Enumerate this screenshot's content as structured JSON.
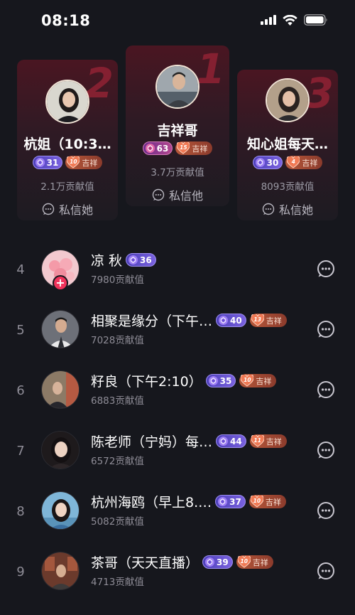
{
  "status_bar": {
    "time": "08:18"
  },
  "podium": [
    {
      "rank": "2",
      "name": "杭姐（10:3…",
      "level": "31",
      "fan_level": "10",
      "fan_name": "吉祥",
      "value": "2.1万贡献值",
      "action": "私信她"
    },
    {
      "rank": "1",
      "name": "吉祥哥",
      "level": "63",
      "fan_level": "15",
      "fan_name": "吉祥",
      "value": "3.7万贡献值",
      "action": "私信他"
    },
    {
      "rank": "3",
      "name": "知心姐每天…",
      "level": "30",
      "fan_level": "4",
      "fan_name": "吉祥",
      "value": "8093贡献值",
      "action": "私信她"
    }
  ],
  "list": [
    {
      "rank": "4",
      "name": "凉 秋",
      "level": "36",
      "fan_level": "",
      "fan_name": "",
      "value": "7980贡献值"
    },
    {
      "rank": "5",
      "name": "相聚是缘分（下午…",
      "level": "40",
      "fan_level": "13",
      "fan_name": "吉祥",
      "value": "7028贡献值"
    },
    {
      "rank": "6",
      "name": "籽良（下午2:10）",
      "level": "35",
      "fan_level": "10",
      "fan_name": "吉祥",
      "value": "6883贡献值"
    },
    {
      "rank": "7",
      "name": "陈老师（宁妈）每…",
      "level": "44",
      "fan_level": "11",
      "fan_name": "吉祥",
      "value": "6572贡献值"
    },
    {
      "rank": "8",
      "name": "杭州海鸥（早上8.…",
      "level": "37",
      "fan_level": "10",
      "fan_name": "吉祥",
      "value": "5082贡献值"
    },
    {
      "rank": "9",
      "name": "茶哥（天天直播）",
      "level": "39",
      "fan_level": "10",
      "fan_name": "吉祥",
      "value": "4713贡献值"
    }
  ],
  "icons": {
    "signal": "signal-icon",
    "wifi": "wifi-icon",
    "battery": "battery-icon",
    "message": "message-bubble-icon",
    "gem": "gem-icon",
    "heart": "heart-badge-icon",
    "plus": "plus-icon"
  },
  "colors": {
    "background": "#16171d",
    "rank_red": "#8c2233",
    "level_purple": "#6a56d8",
    "fan_orange": "#b8583a",
    "plus_red": "#f0335b"
  }
}
